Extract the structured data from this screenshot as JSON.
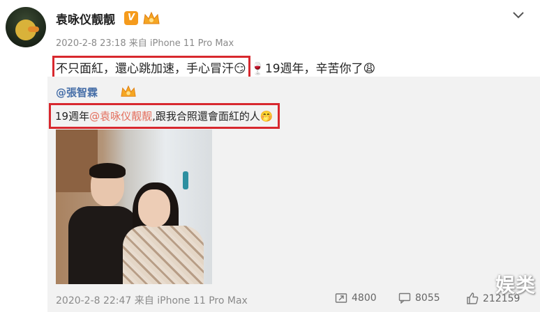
{
  "post": {
    "username": "袁咏仪靓靓",
    "verified_badge": "V",
    "timestamp": "2020-2-8 23:18",
    "source": "来自 iPhone 11 Pro Max",
    "text_highlight": "不只面紅，還心跳加速，手心冒汗😏",
    "text_rest": "🍷19週年，辛苦你了😩"
  },
  "repost": {
    "username": "@張智霖",
    "text_prefix": "19週年",
    "mention": "@袁咏仪靓靓",
    "text_suffix": ",跟我合照還會面紅的人🤭",
    "timestamp": "2020-2-8 22:47",
    "source": "来自 iPhone 11 Pro Max",
    "stats": {
      "reposts": "4800",
      "comments": "8055",
      "likes": "212159"
    }
  },
  "watermark": "娱类",
  "icons": [
    "chevron-down-icon",
    "crown-icon",
    "repost-icon",
    "comment-icon",
    "like-icon"
  ],
  "colors": {
    "highlight_border": "#d8282e",
    "mention": "#e36d5b",
    "repost_user": "#476fa8",
    "verified": "#f59b1c"
  }
}
